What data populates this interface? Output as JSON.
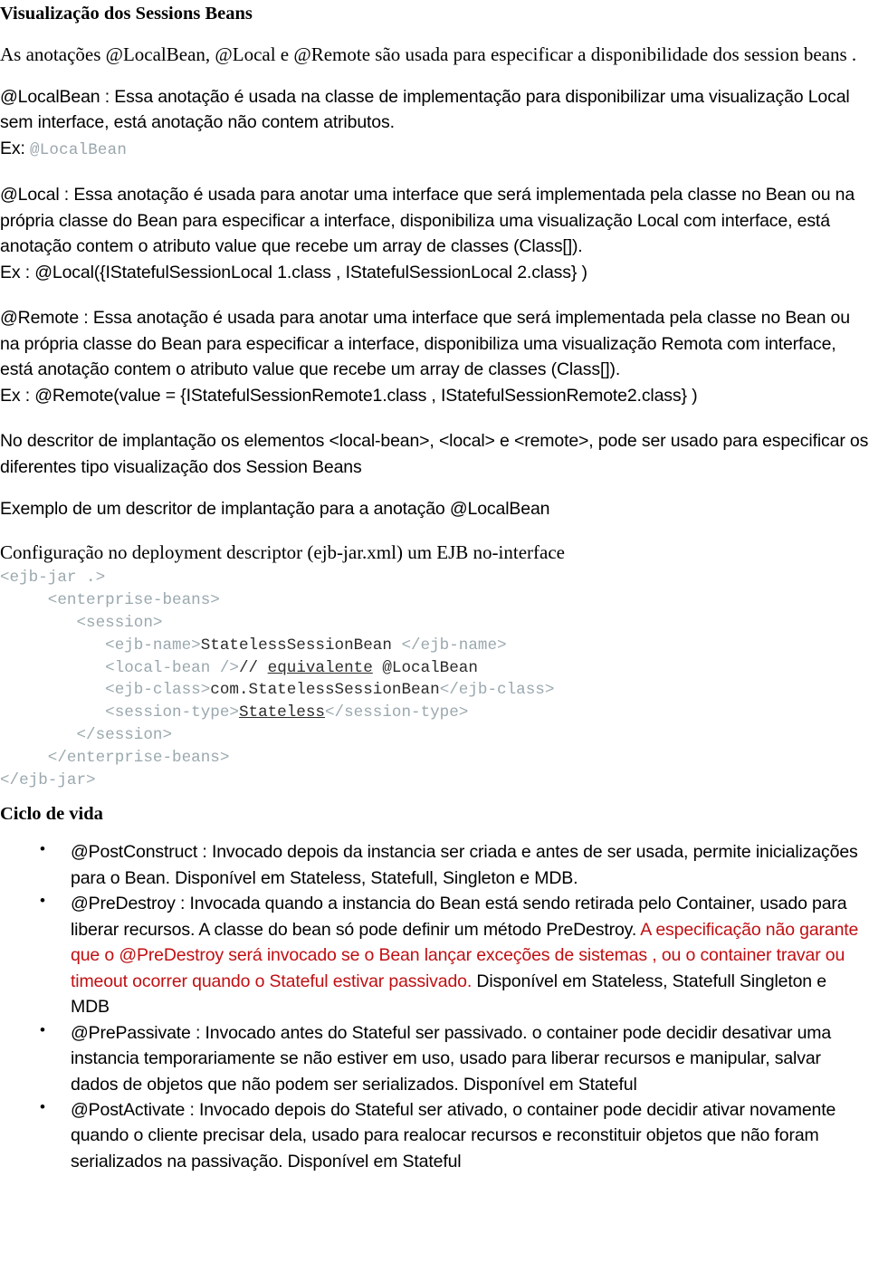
{
  "document": {
    "title": "Visualização dos Sessions Beans",
    "intro_paragraph": "As anotações  @LocalBean, @Local e @Remote são usada para especificar a disponibilidade dos session beans .",
    "localbean": {
      "paragraph": "@LocalBean : Essa anotação é usada na classe de implementação para disponibilizar uma visualização Local sem interface, está anotação não contem atributos.",
      "ex_label": "Ex:",
      "ex_code": "@LocalBean"
    },
    "local": {
      "paragraph": "@Local  : Essa anotação é usada para anotar uma interface que será implementada pela classe no Bean ou na própria classe do Bean para especificar a interface, disponibiliza uma visualização Local com interface, está anotação contem o atributo value que recebe um array de classes (Class[]).",
      "example": "Ex : @Local({IStatefulSessionLocal 1.class , IStatefulSessionLocal 2.class}  )"
    },
    "remote": {
      "paragraph": "@Remote : Essa anotação é usada para anotar uma interface que será implementada pela classe no Bean ou na própria classe do Bean para especificar a interface, disponibiliza uma visualização Remota com interface, está anotação contem o atributo value que recebe um array de classes (Class[]).",
      "example": "Ex : @Remote(value = {IStatefulSessionRemote1.class , IStatefulSessionRemote2.class}  )"
    },
    "descriptor_note": "No descritor de implantação os elementos  <local-bean>, <local> e <remote>,  pode ser usado para especificar os diferentes tipo visualização dos Session Beans",
    "descriptor_example_intro": "Exemplo de um descritor de implantação para a anotação @LocalBean",
    "config_heading": "Configuração no deployment descriptor (ejb-jar.xml) um EJB no-interface",
    "code": {
      "lines": [
        [
          {
            "t": "tag",
            "s": "<ejb-jar .>"
          }
        ],
        [
          {
            "t": "tag",
            "s": "     <enterprise-beans>"
          }
        ],
        [
          {
            "t": "tag",
            "s": "        <session>"
          }
        ],
        [
          {
            "t": "tag",
            "s": "           <ejb-name>"
          },
          {
            "t": "txt",
            "s": "StatelessSessionBean "
          },
          {
            "t": "tag",
            "s": "</ejb-name>"
          }
        ],
        [
          {
            "t": "tag",
            "s": "           <local-bean />"
          },
          {
            "t": "txt",
            "s": "// "
          },
          {
            "t": "txtu",
            "s": "equivalente"
          },
          {
            "t": "txt",
            "s": " @LocalBean"
          }
        ],
        [
          {
            "t": "tag",
            "s": "           <ejb-class>"
          },
          {
            "t": "txt",
            "s": "com.StatelessSessionBean"
          },
          {
            "t": "tag",
            "s": "</ejb-class>"
          }
        ],
        [
          {
            "t": "tag",
            "s": "           <session-type>"
          },
          {
            "t": "txtu",
            "s": "Stateless"
          },
          {
            "t": "tag",
            "s": "</session-type>"
          }
        ],
        [
          {
            "t": "tag",
            "s": "        </session>"
          }
        ],
        [
          {
            "t": "tag",
            "s": "     </enterprise-beans>"
          }
        ],
        [
          {
            "t": "tag",
            "s": "</ejb-jar>"
          }
        ]
      ]
    },
    "lifecycle": {
      "heading": "Ciclo de vida",
      "items": [
        {
          "black_before": "@PostConstruct : Invocado depois da instancia ser criada e antes de ser usada, permite inicializações para o Bean. Disponível em Stateless, Statefull, Singleton e MDB.",
          "red": "",
          "black_after": ""
        },
        {
          "black_before": "@PreDestroy : Invocada quando a instancia do Bean está sendo retirada pelo Container, usado para liberar recursos. A classe do bean só pode definir um método PreDestroy. ",
          "red": "A especificação não garante que o  @PreDestroy será invocado se o Bean  lançar exceções de sistemas , ou o container travar ou timeout ocorrer quando o Stateful estivar  passivado.",
          "black_after": " Disponível em Stateless, Statefull Singleton e MDB"
        },
        {
          "black_before": "@PrePassivate : Invocado antes do Stateful ser passivado.  o container pode decidir desativar uma instancia temporariamente se não estiver em uso, usado para liberar recursos e manipular, salvar dados de objetos que não podem ser serializados. Disponível em Stateful",
          "red": "",
          "black_after": ""
        },
        {
          "black_before": "@PostActivate : Invocado depois do Stateful ser ativado, o container pode decidir ativar novamente quando o cliente precisar dela, usado para realocar recursos e reconstituir objetos que não foram serializados na passivação. Disponível em Stateful",
          "red": "",
          "black_after": ""
        }
      ]
    },
    "colors": {
      "text": "#000000",
      "red_highlight": "#c00f12",
      "xml_tag": "#9aa8ae",
      "xml_content": "#2b2b2b",
      "mono_gray": "#9aa6ad"
    }
  }
}
